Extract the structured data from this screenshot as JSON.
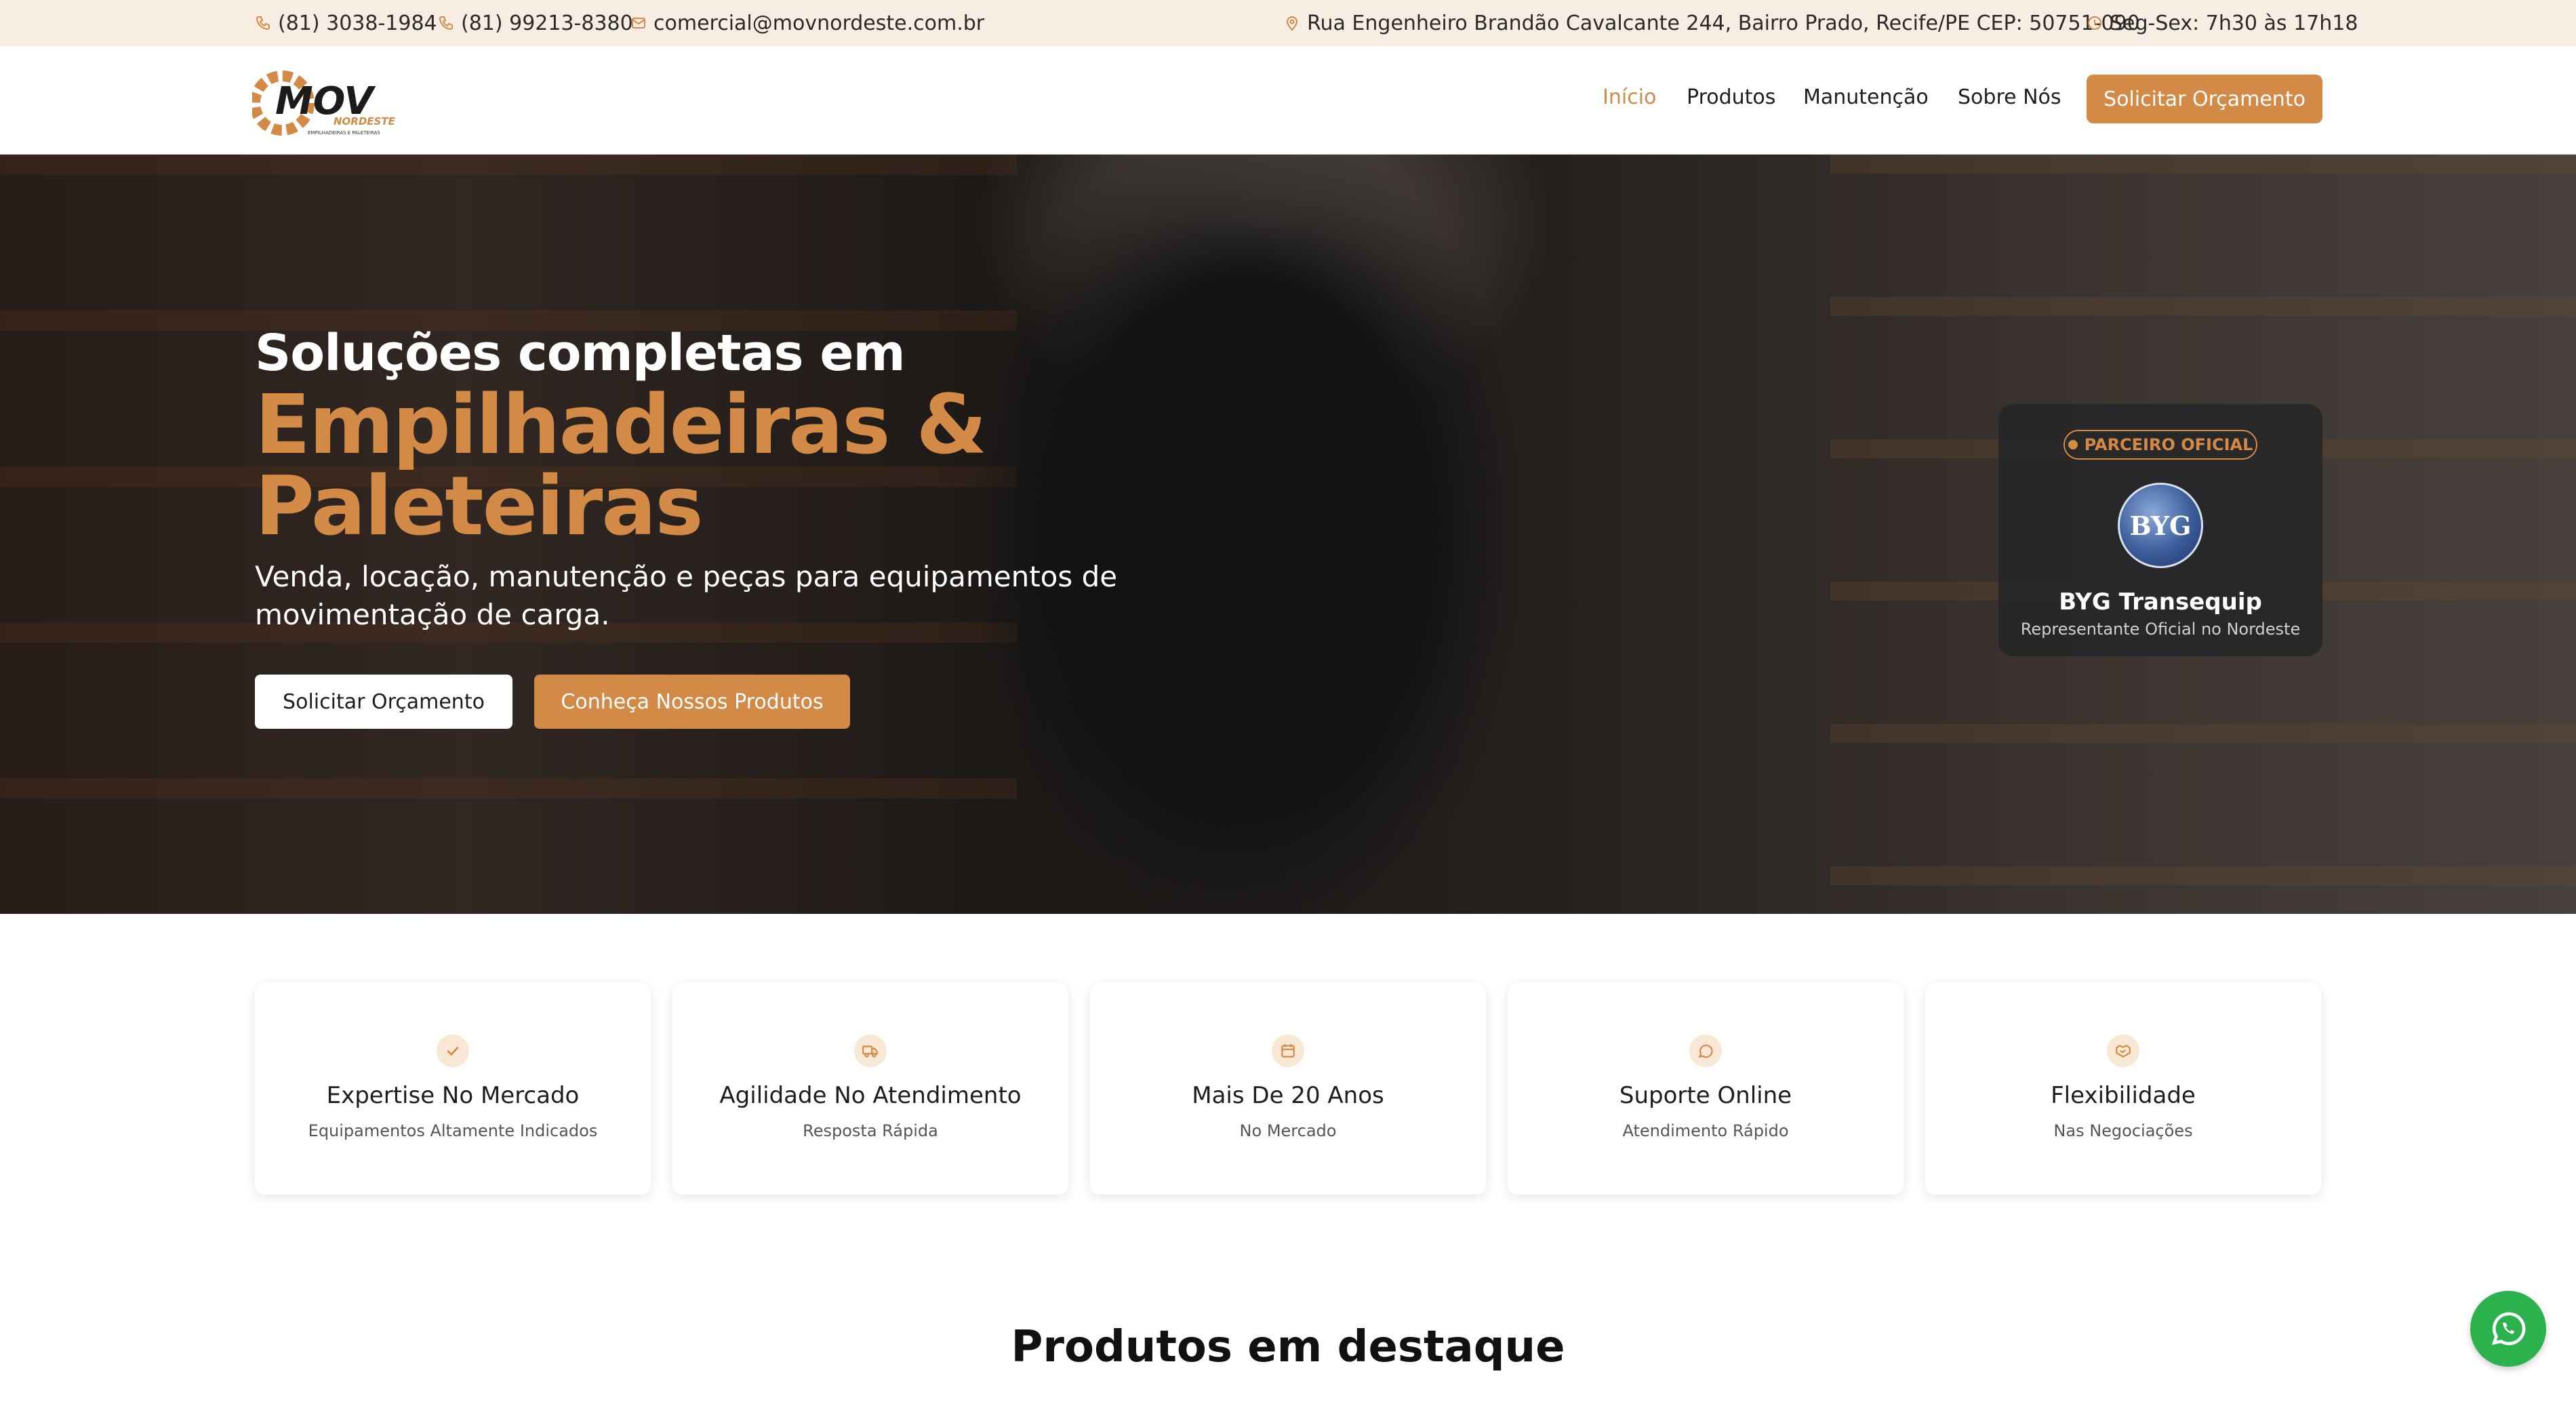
{
  "topbar": {
    "phone1": "(81) 3038-1984",
    "phone2": "(81) 99213-8380",
    "email": "comercial@movnordeste.com.br",
    "address": "Rua Engenheiro Brandão Cavalcante 244, Bairro Prado, Recife/PE CEP: 50751-090",
    "hours": "Seg-Sex: 7h30 às 17h18"
  },
  "header": {
    "logo_text": "MOV",
    "logo_sub": "NORDESTE",
    "logo_tagline": "EMPILHADEIRAS E PALETEIRAS",
    "nav": [
      "Início",
      "Produtos",
      "Manutenção",
      "Sobre Nós"
    ],
    "cta": "Solicitar Orçamento"
  },
  "hero": {
    "pre_title": "Soluções completas em",
    "title_line1": "Empilhadeiras &",
    "title_line2": "Paleteiras",
    "subtitle": "Venda, locação, manutenção e peças para equipamentos de movimentação de carga.",
    "btn_primary": "Solicitar Orçamento",
    "btn_secondary": "Conheça Nossos Produtos"
  },
  "partner": {
    "badge": "PARCEIRO OFICIAL",
    "logo_text": "BYG",
    "name": "BYG Transequip",
    "desc": "Representante Oficial no Nordeste"
  },
  "features": [
    {
      "title": "Expertise No Mercado",
      "subtitle": "Equipamentos Altamente Indicados",
      "icon": "check-icon"
    },
    {
      "title": "Agilidade No Atendimento",
      "subtitle": "Resposta Rápida",
      "icon": "truck-icon"
    },
    {
      "title": "Mais De 20 Anos",
      "subtitle": "No Mercado",
      "icon": "calendar-icon"
    },
    {
      "title": "Suporte Online",
      "subtitle": "Atendimento Rápido",
      "icon": "chat-icon"
    },
    {
      "title": "Flexibilidade",
      "subtitle": "Nas Negociações",
      "icon": "handshake-icon"
    }
  ],
  "products": {
    "section_title": "Produtos em destaque"
  },
  "colors": {
    "accent": "#d28a46",
    "topbar_bg": "#f7ede3",
    "whatsapp": "#2bb24c"
  }
}
